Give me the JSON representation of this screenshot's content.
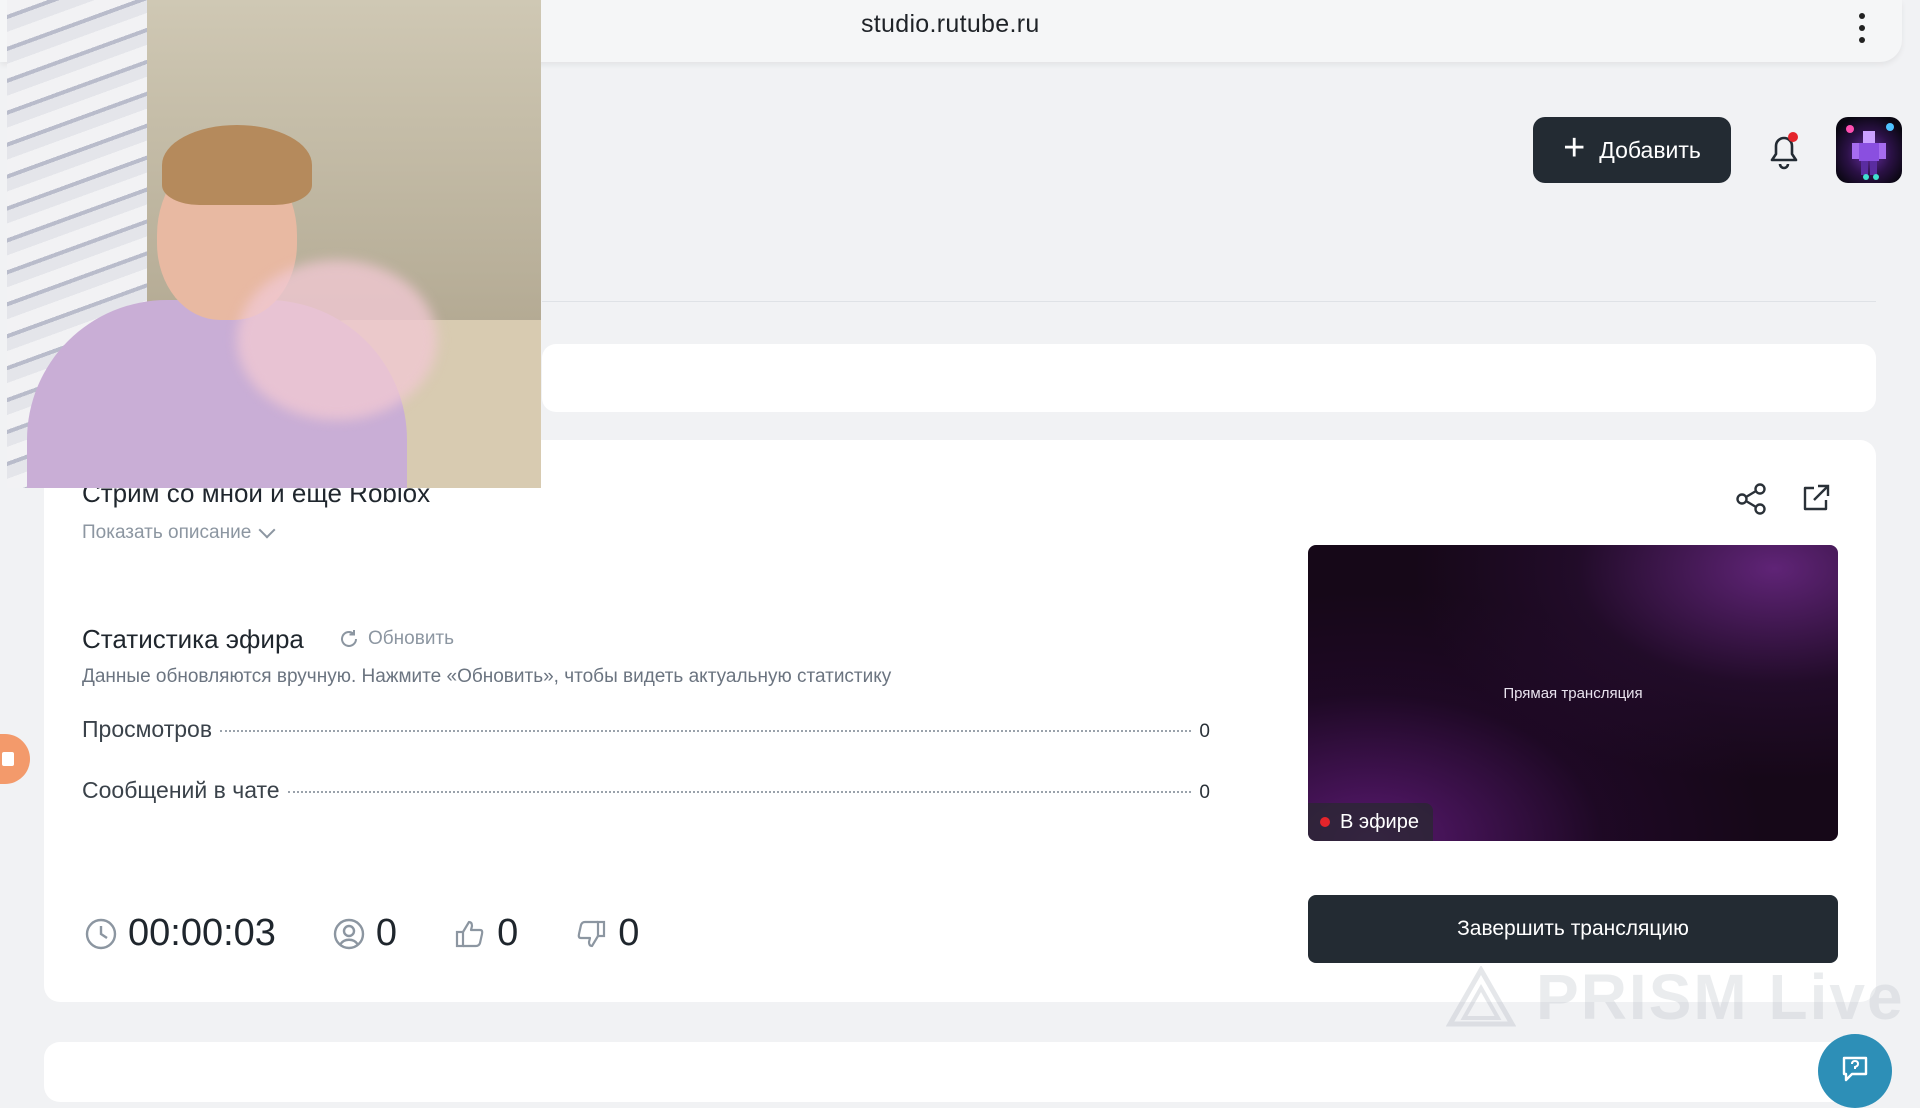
{
  "browser": {
    "url": "studio.rutube.ru"
  },
  "header": {
    "add_label": "Добавить"
  },
  "stream": {
    "title": "Стрим со мной и еще Roblox",
    "show_description": "Показать описание"
  },
  "stats": {
    "title": "Статистика эфира",
    "refresh_label": "Обновить",
    "note": "Данные обновляются вручную. Нажмите «Обновить», чтобы видеть актуальную статистику",
    "rows": [
      {
        "label": "Просмотров",
        "value": "0"
      },
      {
        "label": "Сообщений в чате",
        "value": "0"
      }
    ]
  },
  "counters": {
    "duration": "00:00:03",
    "viewers": "0",
    "likes": "0",
    "dislikes": "0"
  },
  "preview": {
    "label": "Прямая трансляция",
    "live_badge": "В эфире"
  },
  "actions": {
    "end_label": "Завершить трансляцию"
  },
  "overlay": {
    "watermark": "PRISM Live"
  },
  "colors": {
    "dark_button": "#232b33",
    "live_dot": "#e5242b",
    "accent_fab": "#2d8fb7"
  }
}
